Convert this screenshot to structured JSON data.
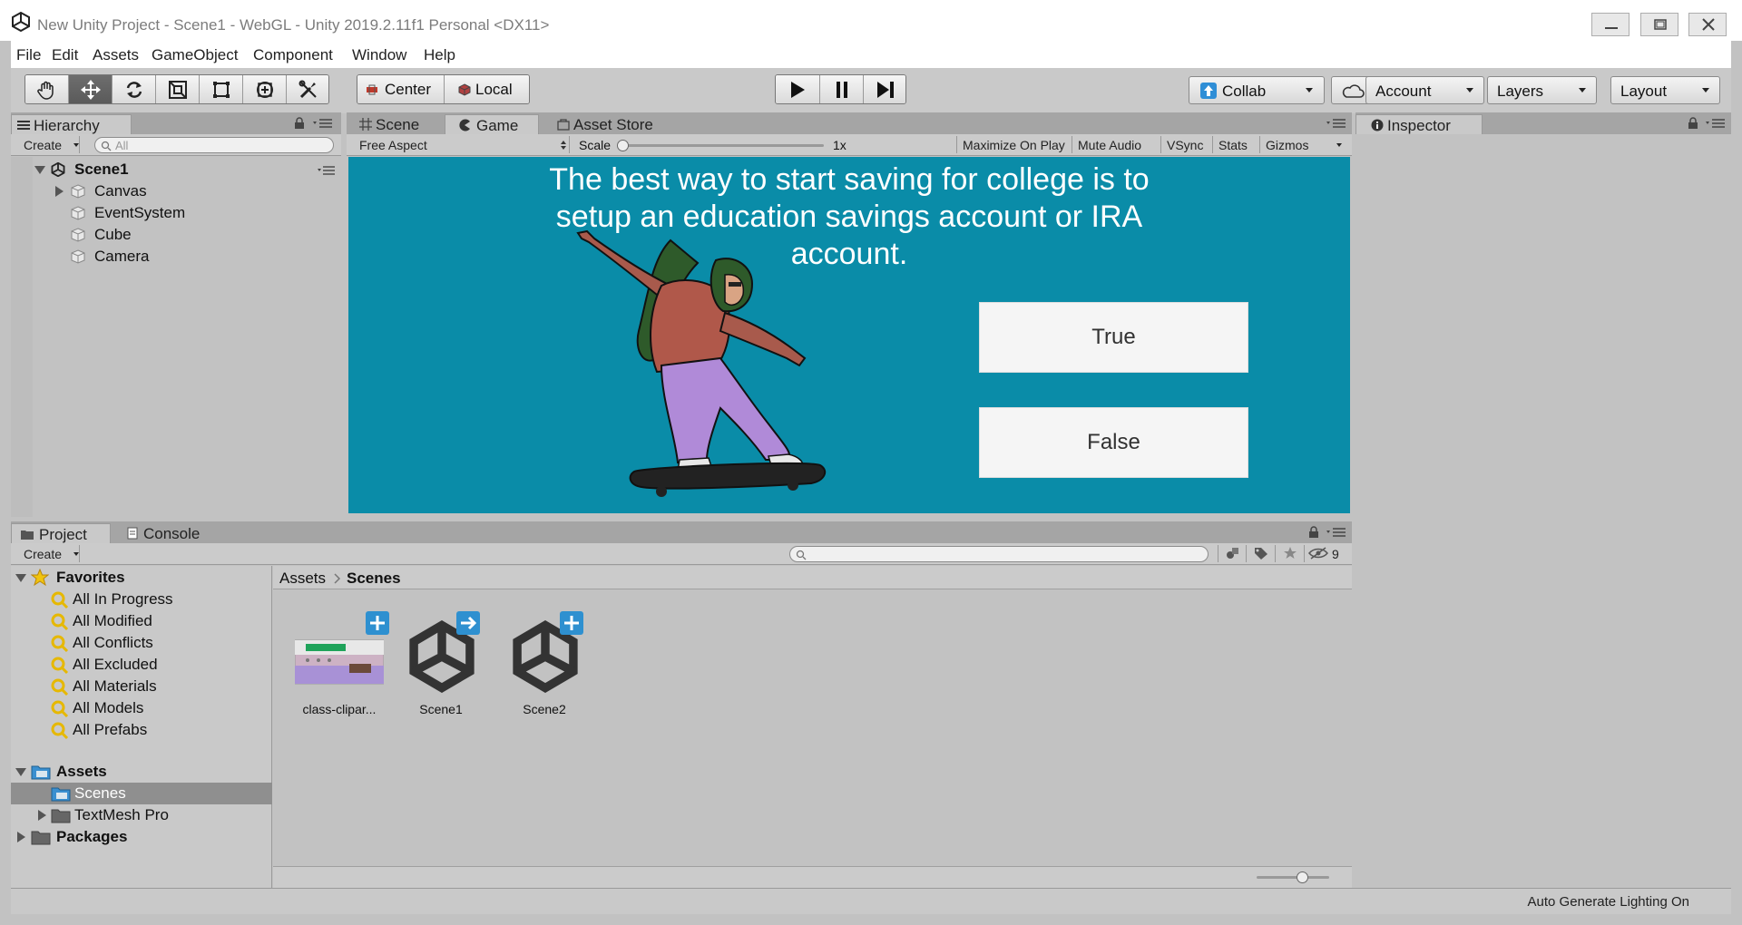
{
  "window": {
    "title": "New Unity Project - Scene1 - WebGL - Unity 2019.2.11f1 Personal <DX11>"
  },
  "menu": {
    "items": [
      "File",
      "Edit",
      "Assets",
      "GameObject",
      "Component",
      "Window",
      "Help"
    ]
  },
  "toolbar": {
    "pivot_mode": "Center",
    "pivot_rotation": "Local",
    "collab_label": "Collab",
    "account_label": "Account",
    "layers_label": "Layers",
    "layout_label": "Layout"
  },
  "hierarchy": {
    "tab_label": "Hierarchy",
    "create_label": "Create",
    "search_placeholder": "All",
    "scene_name": "Scene1",
    "items": [
      "Canvas",
      "EventSystem",
      "Cube",
      "Camera"
    ]
  },
  "viewtabs": {
    "scene": "Scene",
    "game": "Game",
    "asset_store": "Asset Store"
  },
  "gamebar": {
    "aspect": "Free Aspect",
    "scale_label": "Scale",
    "scale_value": "1x",
    "maximize": "Maximize On Play",
    "mute": "Mute Audio",
    "vsync": "VSync",
    "stats": "Stats",
    "gizmos": "Gizmos"
  },
  "game": {
    "question_line1": "The best way to start saving for college is to",
    "question_line2": "setup an education savings account or IRA",
    "question_line3": "account.",
    "true_label": "True",
    "false_label": "False",
    "bg_color": "#0a8ca8"
  },
  "inspector": {
    "tab_label": "Inspector"
  },
  "project": {
    "tab_label": "Project",
    "console_label": "Console",
    "create_label": "Create",
    "hidden_count": "9",
    "favorites_label": "Favorites",
    "favorites": [
      "All In Progress",
      "All Modified",
      "All Conflicts",
      "All Excluded",
      "All Materials",
      "All Models",
      "All Prefabs"
    ],
    "assets_label": "Assets",
    "asset_folders": [
      "Scenes",
      "TextMesh Pro"
    ],
    "packages_label": "Packages",
    "breadcrumb_root": "Assets",
    "breadcrumb_current": "Scenes",
    "files": [
      "class-clipar...",
      "Scene1",
      "Scene2"
    ]
  },
  "status": {
    "text": "Auto Generate Lighting On"
  }
}
